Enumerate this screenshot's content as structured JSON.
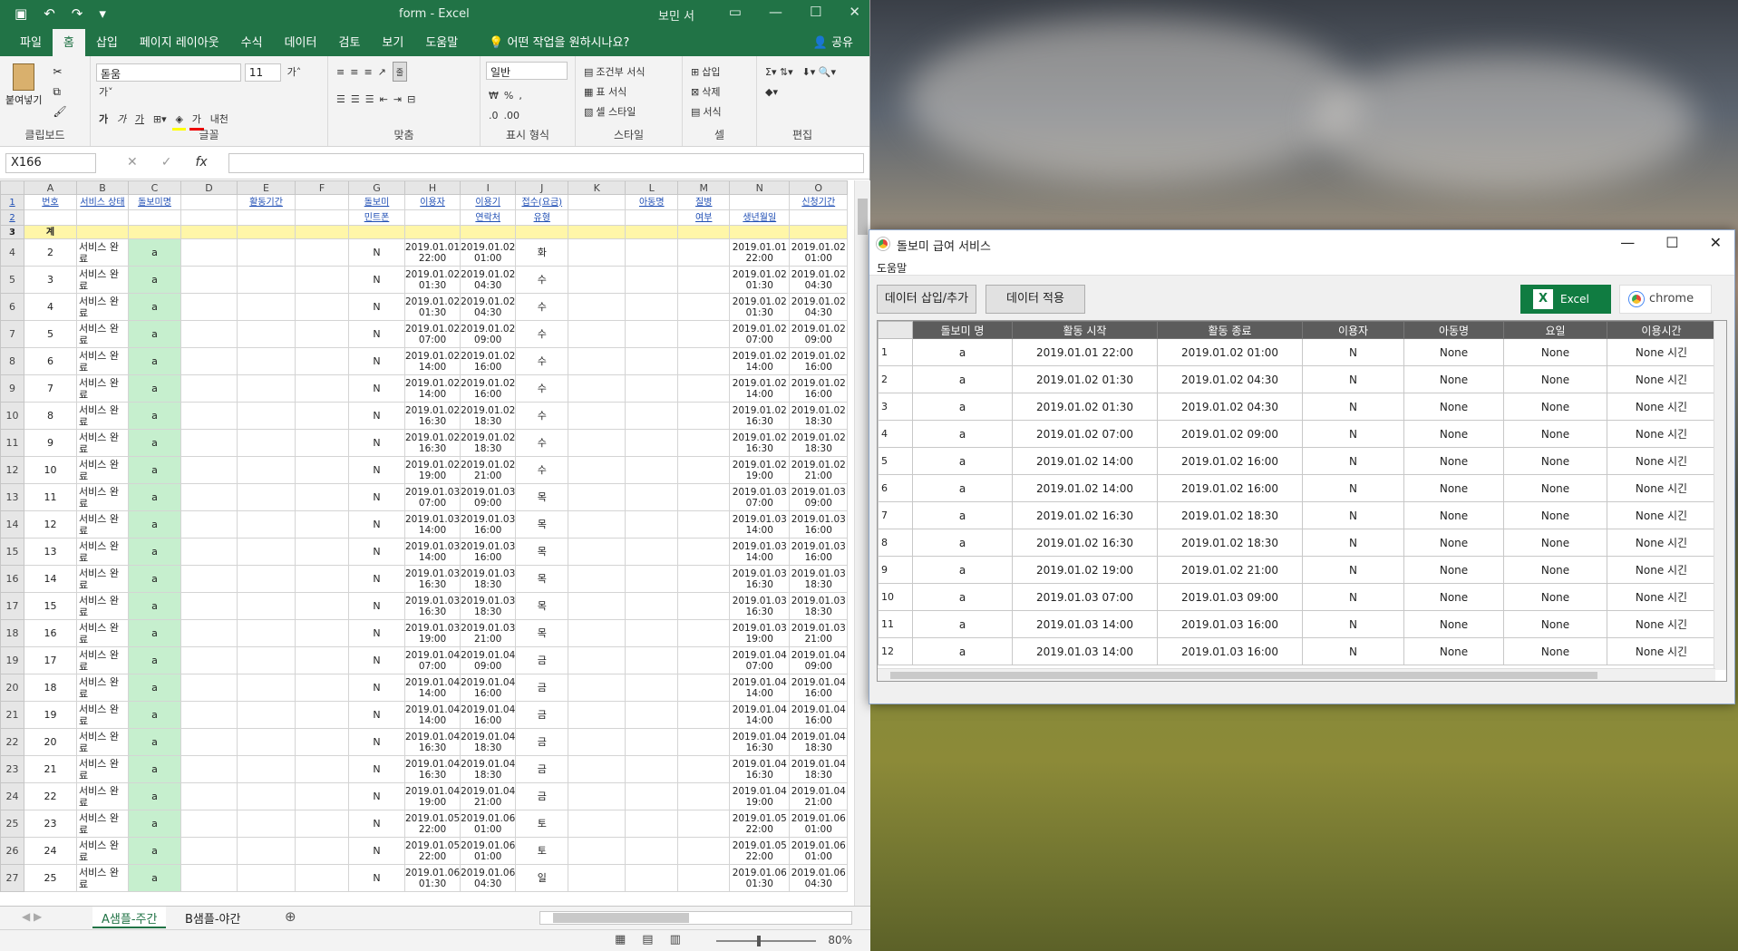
{
  "excel": {
    "window_title": "form  -  Excel",
    "user": "보민 서",
    "menu": [
      "파일",
      "홈",
      "삽입",
      "페이지 레이아웃",
      "수식",
      "데이터",
      "검토",
      "보기",
      "도움말"
    ],
    "tell_me": "어떤 작업을 원하시나요?",
    "share": "공유",
    "ribbon": {
      "paste": "붙여넣기",
      "clipboard": "클립보드",
      "font_name": "돋움",
      "font_size": "11",
      "font": "글꼴",
      "align": "맞춤",
      "wrap": "자동 줄 바꿈",
      "number_format": "일반",
      "number": "표시 형식",
      "cond_format": "조건부 서식",
      "table_format": "표 서식",
      "cell_style": "셀 스타일",
      "style": "스타일",
      "insert": "삽입",
      "delete": "삭제",
      "format": "서식",
      "cells": "셀",
      "editing": "편집"
    },
    "name_box": "X166",
    "columns": [
      "A",
      "B",
      "C",
      "D",
      "E",
      "F",
      "G",
      "H",
      "I",
      "J",
      "K",
      "L",
      "M",
      "N",
      "O"
    ],
    "header1": [
      "번호",
      "서비스 상태",
      "돌보미명",
      "",
      "활동기간",
      "",
      "돌보미",
      "이용자",
      "이용기",
      "접수(요금)",
      "",
      "아동명",
      "질병",
      "",
      "신청기간",
      ""
    ],
    "header2": [
      "",
      "",
      "",
      "",
      "",
      "",
      "민트폰",
      "",
      "연락처",
      "유형",
      "",
      "",
      "여부",
      "생년월일",
      "",
      ""
    ],
    "header3": [
      "계"
    ],
    "rows": [
      {
        "r": "4",
        "no": "2",
        "st": "서비스 완료",
        "nm": "a",
        "u": "N",
        "h": "2019.01.01 22:00",
        "i": "2019.01.02 01:00",
        "d": "화",
        "n": "2019.01.01 22:00",
        "o": "2019.01.02 01:00"
      },
      {
        "r": "5",
        "no": "3",
        "st": "서비스 완료",
        "nm": "a",
        "u": "N",
        "h": "2019.01.02 01:30",
        "i": "2019.01.02 04:30",
        "d": "수",
        "n": "2019.01.02 01:30",
        "o": "2019.01.02 04:30"
      },
      {
        "r": "6",
        "no": "4",
        "st": "서비스 완료",
        "nm": "a",
        "u": "N",
        "h": "2019.01.02 01:30",
        "i": "2019.01.02 04:30",
        "d": "수",
        "n": "2019.01.02 01:30",
        "o": "2019.01.02 04:30"
      },
      {
        "r": "7",
        "no": "5",
        "st": "서비스 완료",
        "nm": "a",
        "u": "N",
        "h": "2019.01.02 07:00",
        "i": "2019.01.02 09:00",
        "d": "수",
        "n": "2019.01.02 07:00",
        "o": "2019.01.02 09:00"
      },
      {
        "r": "8",
        "no": "6",
        "st": "서비스 완료",
        "nm": "a",
        "u": "N",
        "h": "2019.01.02 14:00",
        "i": "2019.01.02 16:00",
        "d": "수",
        "n": "2019.01.02 14:00",
        "o": "2019.01.02 16:00"
      },
      {
        "r": "9",
        "no": "7",
        "st": "서비스 완료",
        "nm": "a",
        "u": "N",
        "h": "2019.01.02 14:00",
        "i": "2019.01.02 16:00",
        "d": "수",
        "n": "2019.01.02 14:00",
        "o": "2019.01.02 16:00"
      },
      {
        "r": "10",
        "no": "8",
        "st": "서비스 완료",
        "nm": "a",
        "u": "N",
        "h": "2019.01.02 16:30",
        "i": "2019.01.02 18:30",
        "d": "수",
        "n": "2019.01.02 16:30",
        "o": "2019.01.02 18:30"
      },
      {
        "r": "11",
        "no": "9",
        "st": "서비스 완료",
        "nm": "a",
        "u": "N",
        "h": "2019.01.02 16:30",
        "i": "2019.01.02 18:30",
        "d": "수",
        "n": "2019.01.02 16:30",
        "o": "2019.01.02 18:30"
      },
      {
        "r": "12",
        "no": "10",
        "st": "서비스 완료",
        "nm": "a",
        "u": "N",
        "h": "2019.01.02 19:00",
        "i": "2019.01.02 21:00",
        "d": "수",
        "n": "2019.01.02 19:00",
        "o": "2019.01.02 21:00"
      },
      {
        "r": "13",
        "no": "11",
        "st": "서비스 완료",
        "nm": "a",
        "u": "N",
        "h": "2019.01.03 07:00",
        "i": "2019.01.03 09:00",
        "d": "목",
        "n": "2019.01.03 07:00",
        "o": "2019.01.03 09:00"
      },
      {
        "r": "14",
        "no": "12",
        "st": "서비스 완료",
        "nm": "a",
        "u": "N",
        "h": "2019.01.03 14:00",
        "i": "2019.01.03 16:00",
        "d": "목",
        "n": "2019.01.03 14:00",
        "o": "2019.01.03 16:00"
      },
      {
        "r": "15",
        "no": "13",
        "st": "서비스 완료",
        "nm": "a",
        "u": "N",
        "h": "2019.01.03 14:00",
        "i": "2019.01.03 16:00",
        "d": "목",
        "n": "2019.01.03 14:00",
        "o": "2019.01.03 16:00"
      },
      {
        "r": "16",
        "no": "14",
        "st": "서비스 완료",
        "nm": "a",
        "u": "N",
        "h": "2019.01.03 16:30",
        "i": "2019.01.03 18:30",
        "d": "목",
        "n": "2019.01.03 16:30",
        "o": "2019.01.03 18:30"
      },
      {
        "r": "17",
        "no": "15",
        "st": "서비스 완료",
        "nm": "a",
        "u": "N",
        "h": "2019.01.03 16:30",
        "i": "2019.01.03 18:30",
        "d": "목",
        "n": "2019.01.03 16:30",
        "o": "2019.01.03 18:30"
      },
      {
        "r": "18",
        "no": "16",
        "st": "서비스 완료",
        "nm": "a",
        "u": "N",
        "h": "2019.01.03 19:00",
        "i": "2019.01.03 21:00",
        "d": "목",
        "n": "2019.01.03 19:00",
        "o": "2019.01.03 21:00"
      },
      {
        "r": "19",
        "no": "17",
        "st": "서비스 완료",
        "nm": "a",
        "u": "N",
        "h": "2019.01.04 07:00",
        "i": "2019.01.04 09:00",
        "d": "금",
        "n": "2019.01.04 07:00",
        "o": "2019.01.04 09:00"
      },
      {
        "r": "20",
        "no": "18",
        "st": "서비스 완료",
        "nm": "a",
        "u": "N",
        "h": "2019.01.04 14:00",
        "i": "2019.01.04 16:00",
        "d": "금",
        "n": "2019.01.04 14:00",
        "o": "2019.01.04 16:00"
      },
      {
        "r": "21",
        "no": "19",
        "st": "서비스 완료",
        "nm": "a",
        "u": "N",
        "h": "2019.01.04 14:00",
        "i": "2019.01.04 16:00",
        "d": "금",
        "n": "2019.01.04 14:00",
        "o": "2019.01.04 16:00"
      },
      {
        "r": "22",
        "no": "20",
        "st": "서비스 완료",
        "nm": "a",
        "u": "N",
        "h": "2019.01.04 16:30",
        "i": "2019.01.04 18:30",
        "d": "금",
        "n": "2019.01.04 16:30",
        "o": "2019.01.04 18:30"
      },
      {
        "r": "23",
        "no": "21",
        "st": "서비스 완료",
        "nm": "a",
        "u": "N",
        "h": "2019.01.04 16:30",
        "i": "2019.01.04 18:30",
        "d": "금",
        "n": "2019.01.04 16:30",
        "o": "2019.01.04 18:30"
      },
      {
        "r": "24",
        "no": "22",
        "st": "서비스 완료",
        "nm": "a",
        "u": "N",
        "h": "2019.01.04 19:00",
        "i": "2019.01.04 21:00",
        "d": "금",
        "n": "2019.01.04 19:00",
        "o": "2019.01.04 21:00"
      },
      {
        "r": "25",
        "no": "23",
        "st": "서비스 완료",
        "nm": "a",
        "u": "N",
        "h": "2019.01.05 22:00",
        "i": "2019.01.06 01:00",
        "d": "토",
        "n": "2019.01.05 22:00",
        "o": "2019.01.06 01:00"
      },
      {
        "r": "26",
        "no": "24",
        "st": "서비스 완료",
        "nm": "a",
        "u": "N",
        "h": "2019.01.05 22:00",
        "i": "2019.01.06 01:00",
        "d": "토",
        "n": "2019.01.05 22:00",
        "o": "2019.01.06 01:00"
      },
      {
        "r": "27",
        "no": "25",
        "st": "서비스 완료",
        "nm": "a",
        "u": "N",
        "h": "2019.01.06 01:30",
        "i": "2019.01.06 04:30",
        "d": "일",
        "n": "2019.01.06 01:30",
        "o": "2019.01.06 04:30"
      }
    ],
    "sheet_tabs": [
      "A샘플-주간",
      "B샘플-야간"
    ],
    "zoom": "80%"
  },
  "dialog": {
    "title": "돌보미 급여 서비스",
    "menu": "도움말",
    "btn_insert": "데이터 삽입/추가",
    "btn_apply": "데이터 적용",
    "btn_excel": "Excel",
    "btn_chrome": "chrome",
    "columns": [
      "돌보미 명",
      "활동 시작",
      "활동 종료",
      "이용자",
      "아동명",
      "요일",
      "이용시간"
    ],
    "rows": [
      [
        "1",
        "a",
        "2019.01.01 22:00",
        "2019.01.02 01:00",
        "N",
        "None",
        "None",
        "None 시긴"
      ],
      [
        "2",
        "a",
        "2019.01.02 01:30",
        "2019.01.02 04:30",
        "N",
        "None",
        "None",
        "None 시긴"
      ],
      [
        "3",
        "a",
        "2019.01.02 01:30",
        "2019.01.02 04:30",
        "N",
        "None",
        "None",
        "None 시긴"
      ],
      [
        "4",
        "a",
        "2019.01.02 07:00",
        "2019.01.02 09:00",
        "N",
        "None",
        "None",
        "None 시긴"
      ],
      [
        "5",
        "a",
        "2019.01.02 14:00",
        "2019.01.02 16:00",
        "N",
        "None",
        "None",
        "None 시긴"
      ],
      [
        "6",
        "a",
        "2019.01.02 14:00",
        "2019.01.02 16:00",
        "N",
        "None",
        "None",
        "None 시긴"
      ],
      [
        "7",
        "a",
        "2019.01.02 16:30",
        "2019.01.02 18:30",
        "N",
        "None",
        "None",
        "None 시긴"
      ],
      [
        "8",
        "a",
        "2019.01.02 16:30",
        "2019.01.02 18:30",
        "N",
        "None",
        "None",
        "None 시긴"
      ],
      [
        "9",
        "a",
        "2019.01.02 19:00",
        "2019.01.02 21:00",
        "N",
        "None",
        "None",
        "None 시긴"
      ],
      [
        "10",
        "a",
        "2019.01.03 07:00",
        "2019.01.03 09:00",
        "N",
        "None",
        "None",
        "None 시긴"
      ],
      [
        "11",
        "a",
        "2019.01.03 14:00",
        "2019.01.03 16:00",
        "N",
        "None",
        "None",
        "None 시긴"
      ],
      [
        "12",
        "a",
        "2019.01.03 14:00",
        "2019.01.03 16:00",
        "N",
        "None",
        "None",
        "None 시긴"
      ]
    ]
  },
  "colors": {
    "excel_green": "#217346",
    "cell_green": "#c6efce",
    "header_yellow": "#fff6a8",
    "grid_header": "#5c5c5c"
  }
}
